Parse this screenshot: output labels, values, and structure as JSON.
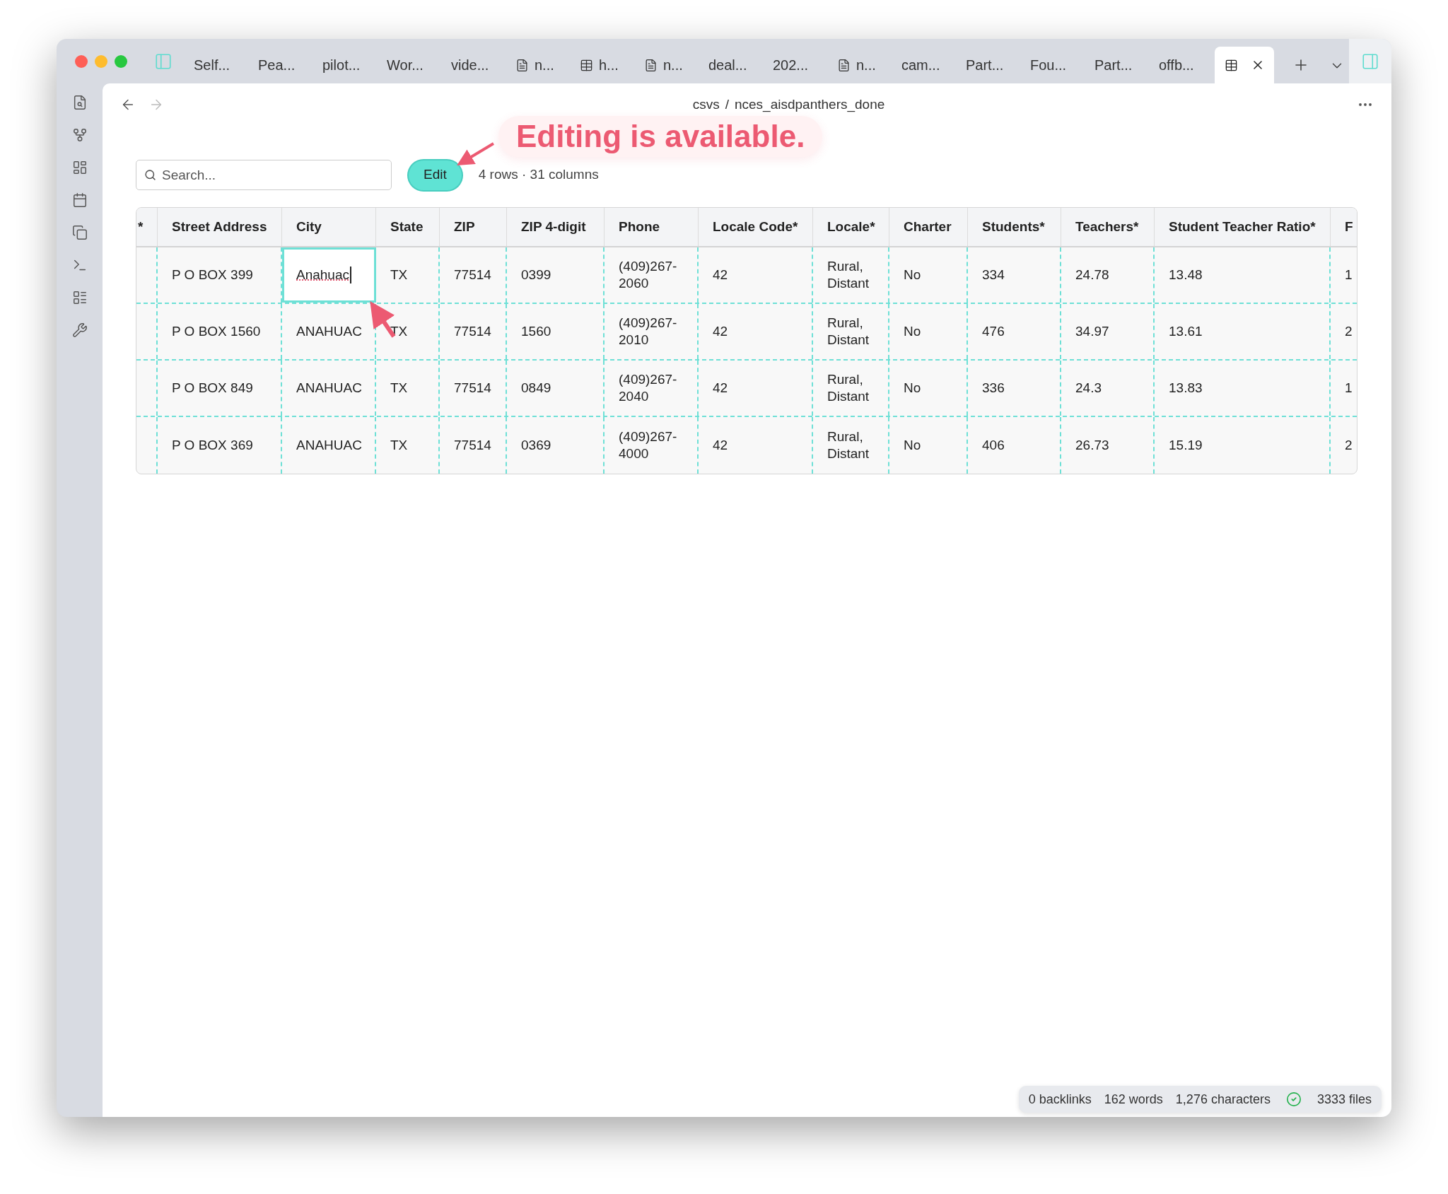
{
  "tabs": [
    {
      "label": "Self...",
      "kind": "note",
      "selected": false
    },
    {
      "label": "Pea...",
      "kind": "note",
      "selected": false
    },
    {
      "label": "pilot...",
      "kind": "note",
      "selected": false
    },
    {
      "label": "Wor...",
      "kind": "note",
      "selected": false
    },
    {
      "label": "vide...",
      "kind": "note",
      "selected": false
    },
    {
      "label": "n...",
      "kind": "doc",
      "selected": false
    },
    {
      "label": "h...",
      "kind": "table",
      "selected": false
    },
    {
      "label": "n...",
      "kind": "doc",
      "selected": false
    },
    {
      "label": "deal...",
      "kind": "note",
      "selected": false
    },
    {
      "label": "202...",
      "kind": "note",
      "selected": false
    },
    {
      "label": "n...",
      "kind": "doc",
      "selected": false
    },
    {
      "label": "cam...",
      "kind": "note",
      "selected": false
    },
    {
      "label": "Part...",
      "kind": "note",
      "selected": false
    },
    {
      "label": "Fou...",
      "kind": "note",
      "selected": false
    },
    {
      "label": "Part...",
      "kind": "note",
      "selected": false
    },
    {
      "label": "offb...",
      "kind": "note",
      "selected": false
    },
    {
      "kind": "table",
      "selected": true
    }
  ],
  "breadcrumb": {
    "folder": "csvs",
    "separator": "/",
    "file": "nces_aisdpanthers_done"
  },
  "callout": "Editing is available.",
  "toolbar": {
    "search": {
      "placeholder": "Search..."
    },
    "edit_button": "Edit",
    "summary": "4 rows · 31 columns"
  },
  "table": {
    "columns": [
      "*",
      "Street Address",
      "City",
      "State",
      "ZIP",
      "ZIP 4-digit",
      "Phone",
      "Locale Code*",
      "Locale*",
      "Charter",
      "Students*",
      "Teachers*",
      "Student Teacher Ratio*",
      "F"
    ],
    "rows": [
      {
        "cells": [
          {
            "text": "",
            "editing": false
          },
          {
            "text": "P O BOX 399",
            "editing": false
          },
          {
            "text": "Anahuac",
            "editing": true
          },
          {
            "text": "TX",
            "editing": false
          },
          {
            "text": "77514",
            "editing": false
          },
          {
            "text": "0399",
            "editing": false
          },
          {
            "text": "(409)267-2060",
            "editing": false
          },
          {
            "text": "42",
            "editing": false
          },
          {
            "text": "Rural, Distant",
            "editing": false
          },
          {
            "text": "No",
            "editing": false
          },
          {
            "text": "334",
            "editing": false
          },
          {
            "text": "24.78",
            "editing": false
          },
          {
            "text": "13.48",
            "editing": false
          },
          {
            "text": "1",
            "editing": false
          }
        ]
      },
      {
        "cells": [
          {
            "text": "",
            "editing": false
          },
          {
            "text": "P O BOX 1560",
            "editing": false
          },
          {
            "text": "ANAHUAC",
            "editing": false
          },
          {
            "text": "TX",
            "editing": false
          },
          {
            "text": "77514",
            "editing": false
          },
          {
            "text": "1560",
            "editing": false
          },
          {
            "text": "(409)267-2010",
            "editing": false
          },
          {
            "text": "42",
            "editing": false
          },
          {
            "text": "Rural, Distant",
            "editing": false
          },
          {
            "text": "No",
            "editing": false
          },
          {
            "text": "476",
            "editing": false
          },
          {
            "text": "34.97",
            "editing": false
          },
          {
            "text": "13.61",
            "editing": false
          },
          {
            "text": "2",
            "editing": false
          }
        ]
      },
      {
        "cells": [
          {
            "text": "",
            "editing": false
          },
          {
            "text": "P O BOX 849",
            "editing": false
          },
          {
            "text": "ANAHUAC",
            "editing": false
          },
          {
            "text": "TX",
            "editing": false
          },
          {
            "text": "77514",
            "editing": false
          },
          {
            "text": "0849",
            "editing": false
          },
          {
            "text": "(409)267-2040",
            "editing": false
          },
          {
            "text": "42",
            "editing": false
          },
          {
            "text": "Rural, Distant",
            "editing": false
          },
          {
            "text": "No",
            "editing": false
          },
          {
            "text": "336",
            "editing": false
          },
          {
            "text": "24.3",
            "editing": false
          },
          {
            "text": "13.83",
            "editing": false
          },
          {
            "text": "1",
            "editing": false
          }
        ]
      },
      {
        "cells": [
          {
            "text": "",
            "editing": false
          },
          {
            "text": "P O BOX 369",
            "editing": false
          },
          {
            "text": "ANAHUAC",
            "editing": false
          },
          {
            "text": "TX",
            "editing": false
          },
          {
            "text": "77514",
            "editing": false
          },
          {
            "text": "0369",
            "editing": false
          },
          {
            "text": "(409)267-4000",
            "editing": false
          },
          {
            "text": "42",
            "editing": false
          },
          {
            "text": "Rural, Distant",
            "editing": false
          },
          {
            "text": "No",
            "editing": false
          },
          {
            "text": "406",
            "editing": false
          },
          {
            "text": "26.73",
            "editing": false
          },
          {
            "text": "15.19",
            "editing": false
          },
          {
            "text": "2",
            "editing": false
          }
        ]
      }
    ]
  },
  "status_bar": {
    "backlinks": "0 backlinks",
    "words": "162 words",
    "characters": "1,276 characters",
    "sync_ok": true,
    "files": "3333 files"
  }
}
